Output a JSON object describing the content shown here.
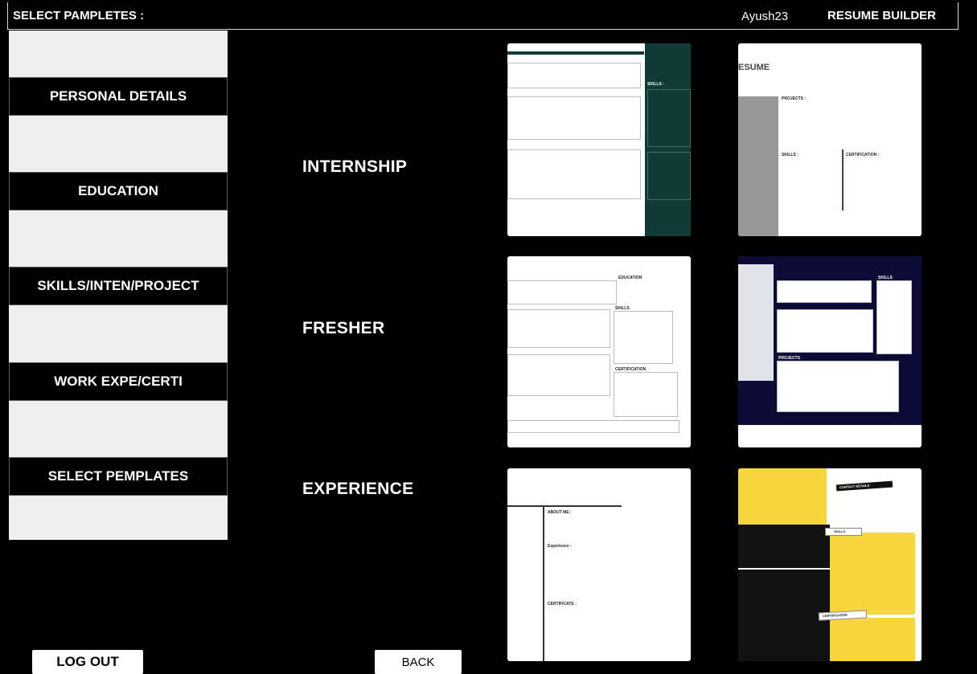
{
  "header": {
    "title": "SELECT PAMPLETES :",
    "user": "Ayush23",
    "brand": "RESUME BUILDER"
  },
  "sidebar": {
    "items": [
      {
        "label": "PERSONAL DETAILS"
      },
      {
        "label": "EDUCATION"
      },
      {
        "label": "SKILLS/INTEN/PROJECT"
      },
      {
        "label": "WORK EXPE/CERTI"
      },
      {
        "label": "SELECT PEMPLATES"
      }
    ]
  },
  "categories": [
    {
      "label": "INTERNSHIP"
    },
    {
      "label": "FRESHER"
    },
    {
      "label": "EXPERIENCE"
    }
  ],
  "templates": {
    "t1": {
      "label": "SKILLS :",
      "color": "#0f3a36"
    },
    "t2": {
      "title": "ESUME",
      "projects": "PROJECTS :",
      "skills": "SKILLS :",
      "certification": "CERTIFICATION :",
      "color": "#999999"
    },
    "t3": {
      "education": "EDUCATION",
      "skills": "SKILLS",
      "certification": "CERTIFICATION"
    },
    "t4": {
      "skills": "SKILLS",
      "projects": "PROJECTS",
      "color": "#0b0b35"
    },
    "t5": {
      "about": "ABOUT ME :",
      "experience": "Experience :",
      "certificate": "CERTIFICATE :"
    },
    "t6": {
      "contact": "CONTACT DETAILS",
      "skills": "SKILLS",
      "certification": "CERTIFICATION",
      "color": "#f7d53d"
    }
  },
  "footer": {
    "logout": "LOG OUT",
    "back": "BACK"
  }
}
